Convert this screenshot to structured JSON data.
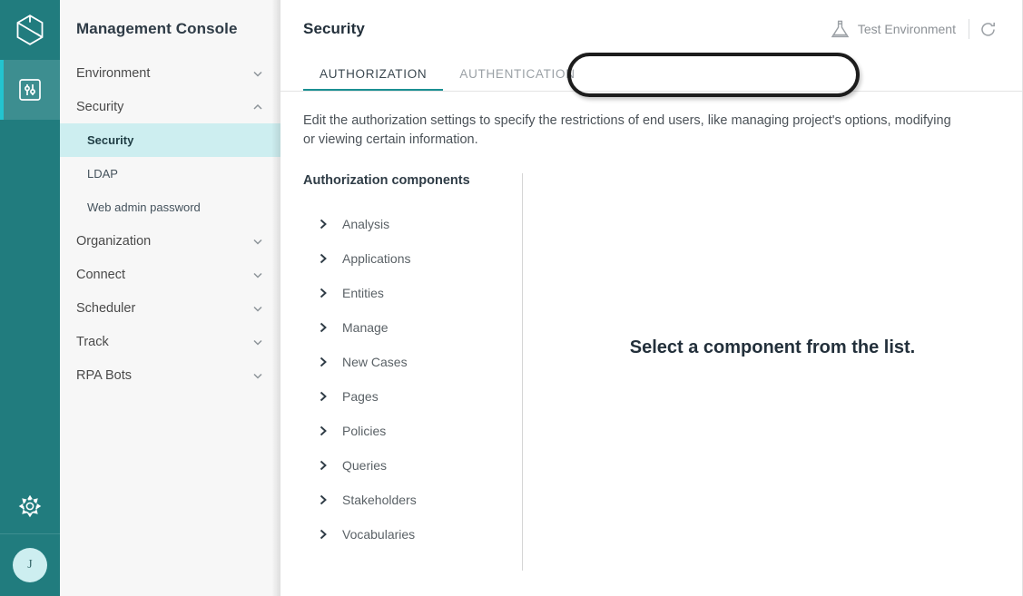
{
  "rail": {
    "logo_icon": "cube-logo-icon",
    "items": [
      {
        "icon": "sliders-icon",
        "name": "rail-item-settings",
        "active": true
      }
    ],
    "gear_icon": "gear-icon",
    "avatar_initial": "J"
  },
  "sidebar": {
    "title": "Management Console",
    "items": [
      {
        "label": "Environment",
        "type": "group",
        "icon": "chevron-down-icon",
        "expanded": false
      },
      {
        "label": "Security",
        "type": "group",
        "icon": "chevron-up-icon",
        "expanded": true
      },
      {
        "label": "Security",
        "type": "sub",
        "active": true
      },
      {
        "label": "LDAP",
        "type": "sub",
        "active": false
      },
      {
        "label": "Web admin password",
        "type": "sub",
        "active": false
      },
      {
        "label": "Organization",
        "type": "group",
        "icon": "chevron-down-icon",
        "expanded": false
      },
      {
        "label": "Connect",
        "type": "group",
        "icon": "chevron-down-icon",
        "expanded": false
      },
      {
        "label": "Scheduler",
        "type": "group",
        "icon": "chevron-down-icon",
        "expanded": false
      },
      {
        "label": "Track",
        "type": "group",
        "icon": "chevron-down-icon",
        "expanded": false
      },
      {
        "label": "RPA Bots",
        "type": "group",
        "icon": "chevron-down-icon",
        "expanded": false
      }
    ]
  },
  "header": {
    "title": "Security",
    "environment_label": "Test Environment",
    "environment_icon": "flask-icon",
    "refresh_icon": "refresh-icon"
  },
  "tabs": [
    {
      "label": "AUTHORIZATION",
      "active": true
    },
    {
      "label": "AUTHENTICATION",
      "active": false
    }
  ],
  "main": {
    "description": "Edit the authorization settings to specify the restrictions of end users, like managing project's options, modifying or viewing certain information.",
    "components_heading": "Authorization components",
    "components": [
      {
        "label": "Analysis",
        "icon": "chevron-right-icon"
      },
      {
        "label": "Applications",
        "icon": "chevron-right-icon"
      },
      {
        "label": "Entities",
        "icon": "chevron-right-icon"
      },
      {
        "label": "Manage",
        "icon": "chevron-right-icon"
      },
      {
        "label": "New Cases",
        "icon": "chevron-right-icon"
      },
      {
        "label": "Pages",
        "icon": "chevron-right-icon"
      },
      {
        "label": "Policies",
        "icon": "chevron-right-icon"
      },
      {
        "label": "Queries",
        "icon": "chevron-right-icon"
      },
      {
        "label": "Stakeholders",
        "icon": "chevron-right-icon"
      },
      {
        "label": "Vocabularies",
        "icon": "chevron-right-icon"
      }
    ],
    "detail_placeholder": "Select a component from the list."
  },
  "annotation": {
    "shape": "ellipse-highlight",
    "target": "tabs"
  },
  "colors": {
    "rail": "#217c7e",
    "rail_item_active": "#3d8e90",
    "rail_accent": "#23c4cf",
    "sidebar_bg": "#f7f7f7",
    "sidebar_active": "#cdeef0",
    "tab_underline": "#1a8f92",
    "text_dark": "#23303b",
    "text_muted": "#8c9196",
    "annotation": "#1c1c1c"
  }
}
